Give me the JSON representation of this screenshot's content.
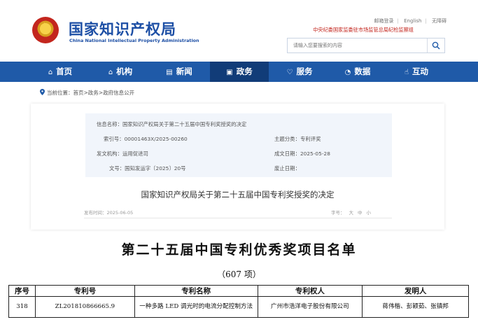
{
  "header": {
    "site_name_cn": "国家知识产权局",
    "site_name_en": "China National Intellectual Property Administration",
    "top_links": [
      "邮箱登录",
      "English",
      "无障碍"
    ],
    "report_line": "中央纪委国家监委驻市场监管总局纪检监察组",
    "search_placeholder": "请输入您要搜索的内容"
  },
  "nav": [
    {
      "label": "首页",
      "icon": "home-icon",
      "glyph": "⌂"
    },
    {
      "label": "机构",
      "icon": "building-icon",
      "glyph": "🏛"
    },
    {
      "label": "新闻",
      "icon": "news-icon",
      "glyph": "▤"
    },
    {
      "label": "政务",
      "icon": "document-icon",
      "glyph": "🗎"
    },
    {
      "label": "服务",
      "icon": "service-icon",
      "glyph": "⚙"
    },
    {
      "label": "数据",
      "icon": "chart-icon",
      "glyph": "◔"
    },
    {
      "label": "互动",
      "icon": "interaction-icon",
      "glyph": "☝"
    }
  ],
  "breadcrumb": "当前位置：首页>政务>政府信息公开",
  "info": {
    "info_name": "信息名称：国家知识产权局关于第二十五届中国专利奖授奖的决定",
    "index_no": "索引号：00001463X/2025-00260",
    "category": "主题分类：专利评奖",
    "issuer": "发文机构：运用促进司",
    "date": "成文日期：2025-05-28",
    "doc_no": "文号：国知发运字〔2025〕20号",
    "expiry": "废止日期："
  },
  "doc_title": "国家知识产权局关于第二十五届中国专利奖授奖的决定",
  "publish_time": "发布时间：2025-06-05",
  "font_size_options": {
    "label": "字号：",
    "large": "大",
    "medium": "中",
    "small": "小"
  },
  "document": {
    "title": "第二十五届中国专利优秀奖项目名单",
    "count": "（607 项）",
    "table_headers": [
      "序号",
      "专利号",
      "专利名称",
      "专利权人",
      "发明人"
    ],
    "rows": [
      [
        "318",
        "ZL201810866665.9",
        "一种多路 LED 调光时的电流分配控制方法",
        "广州市浩洋电子股份有限公司",
        "蒋伟楷、彭颖茹、张镇邦"
      ]
    ]
  },
  "colors": {
    "nav_bg": "#1f5aa8",
    "nav_active": "#113c78",
    "brand_blue": "#1d4fa5",
    "alert_red": "#c3261e"
  }
}
